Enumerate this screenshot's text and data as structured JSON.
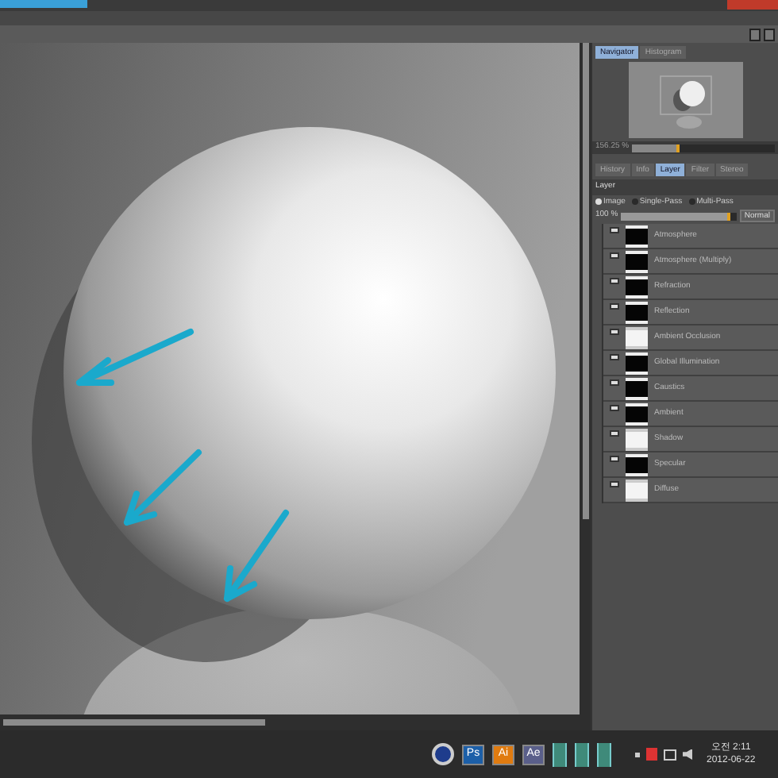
{
  "navigator_panel": {
    "tabs": [
      {
        "label": "Navigator",
        "selected": true
      },
      {
        "label": "Histogram",
        "selected": false
      }
    ],
    "zoom": {
      "reading": "156.25 %",
      "level": 0.33
    }
  },
  "layer_panel": {
    "tabs": [
      {
        "label": "History",
        "selected": false
      },
      {
        "label": "Info",
        "selected": false
      },
      {
        "label": "Layer",
        "selected": true
      },
      {
        "label": "Filter",
        "selected": false
      },
      {
        "label": "Stereo",
        "selected": false
      }
    ],
    "title": "Layer",
    "modes": [
      {
        "label": "Image",
        "selected": true
      },
      {
        "label": "Single-Pass",
        "selected": false
      },
      {
        "label": "Multi-Pass",
        "selected": false
      }
    ],
    "opacity": {
      "reading": "100 %",
      "level": 0.95
    },
    "blend_mode": "Normal",
    "layers": [
      {
        "name": "Atmosphere",
        "kind": "dark"
      },
      {
        "name": "Atmosphere (Multiply)",
        "kind": "dark"
      },
      {
        "name": "Refraction",
        "kind": "dark"
      },
      {
        "name": "Reflection",
        "kind": "dark"
      },
      {
        "name": "Ambient Occlusion",
        "kind": "light"
      },
      {
        "name": "Global Illumination",
        "kind": "dark"
      },
      {
        "name": "Caustics",
        "kind": "dark"
      },
      {
        "name": "Ambient",
        "kind": "dark"
      },
      {
        "name": "Shadow",
        "kind": "light"
      },
      {
        "name": "Specular",
        "kind": "dark"
      },
      {
        "name": "Diffuse",
        "kind": "light"
      }
    ]
  },
  "taskbar": {
    "apps": [
      {
        "kind": "logo"
      },
      {
        "kind": "badge",
        "label": "Ps",
        "color": "#1c5fa8"
      },
      {
        "kind": "badge",
        "label": "Ai",
        "color": "#e07b10"
      },
      {
        "kind": "badge",
        "label": "Ae",
        "color": "#5a5f8a"
      },
      {
        "kind": "book"
      },
      {
        "kind": "book"
      },
      {
        "kind": "book"
      }
    ],
    "clock": {
      "time": "오전 2:11",
      "date": "2012-06-22"
    }
  }
}
